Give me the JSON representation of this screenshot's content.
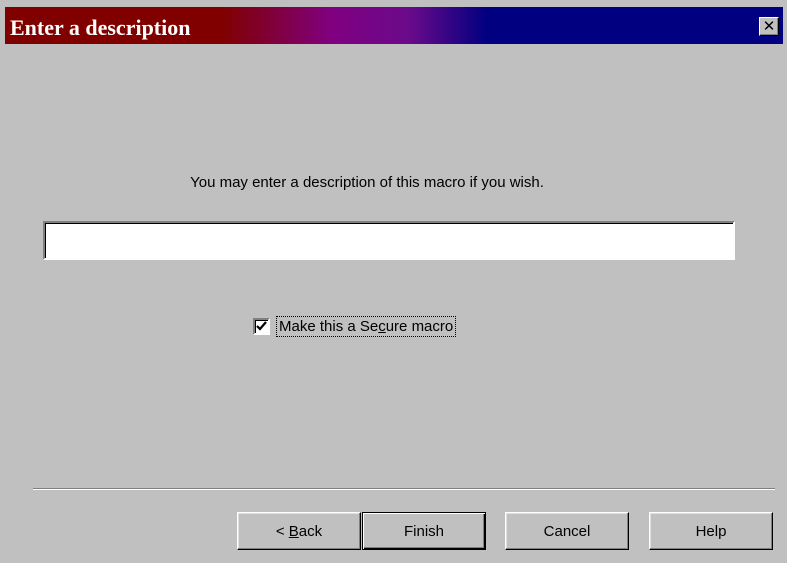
{
  "window": {
    "title": "Enter a description",
    "close_glyph": "✕",
    "close_icon": "close-icon"
  },
  "content": {
    "prompt": "You may enter a description of this macro if you wish.",
    "description_value": "",
    "secure_checkbox": {
      "label_before": "Make this a Se",
      "label_underlined": "c",
      "label_after": "ure macro",
      "checked": true,
      "check_icon": "checkmark-icon"
    }
  },
  "buttons": {
    "back_prefix": "< ",
    "back_mnemonic": "B",
    "back_rest": "ack",
    "finish": "Finish",
    "cancel": "Cancel",
    "help": "Help"
  },
  "colors": {
    "title_gradient_start": "#800000",
    "title_gradient_mid": "#800080",
    "title_gradient_end": "#000080",
    "face": "#c0c0c0"
  }
}
